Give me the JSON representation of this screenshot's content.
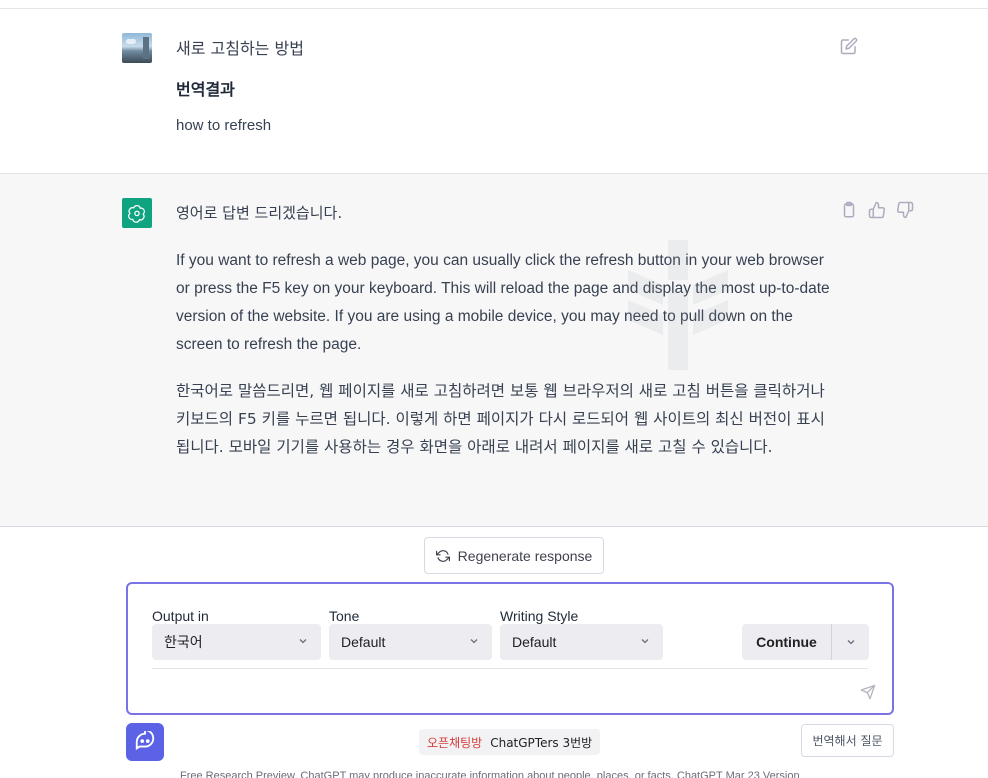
{
  "conversation": {
    "user": {
      "prompt": "새로 고침하는 방법",
      "heading": "번역결과",
      "translation": "how to refresh"
    },
    "assistant": {
      "lead": "영어로 답변 드리겠습니다.",
      "paragraph_en": "If you want to refresh a web page, you can usually click the refresh button in your web browser or press the F5 key on your keyboard. This will reload the page and display the most up-to-date version of the website. If you are using a mobile device, you may need to pull down on the screen to refresh the page.",
      "paragraph_ko": "한국어로 말씀드리면, 웹 페이지를 새로 고침하려면 보통 웹 브라우저의 새로 고침 버튼을 클릭하거나 키보드의 F5 키를 누르면 됩니다. 이렇게 하면 페이지가 다시 로드되어 웹 사이트의 최신 버전이 표시됩니다. 모바일 기기를 사용하는 경우 화면을 아래로 내려서 페이지를 새로 고칠 수 있습니다."
    }
  },
  "regenerate": {
    "label": "Regenerate response"
  },
  "prompt_panel": {
    "output_label": "Output in",
    "output_value": "한국어",
    "tone_label": "Tone",
    "tone_value": "Default",
    "style_label": "Writing Style",
    "style_value": "Default",
    "continue_label": "Continue"
  },
  "bottom": {
    "chip_link": "오픈채팅방",
    "chip_text": "ChatGPTers 3번방",
    "translate_label": "번역해서 질문",
    "footer": "Free Research Preview. ChatGPT may produce inaccurate information about people, places, or facts. ChatGPT Mar 23 Version"
  },
  "icons": {
    "edit": "edit-icon",
    "copy": "clipboard-icon",
    "like": "thumbs-up-icon",
    "dislike": "thumbs-down-icon",
    "regenerate": "refresh-icon",
    "send": "send-icon",
    "bot": "bot-face-icon"
  },
  "colors": {
    "assistant_bg": "#f7f7f8",
    "gpt_green": "#10a37f",
    "panel_border": "#7a73e6",
    "bot_button": "#5b62e6",
    "chip_link": "#d63b3b"
  }
}
